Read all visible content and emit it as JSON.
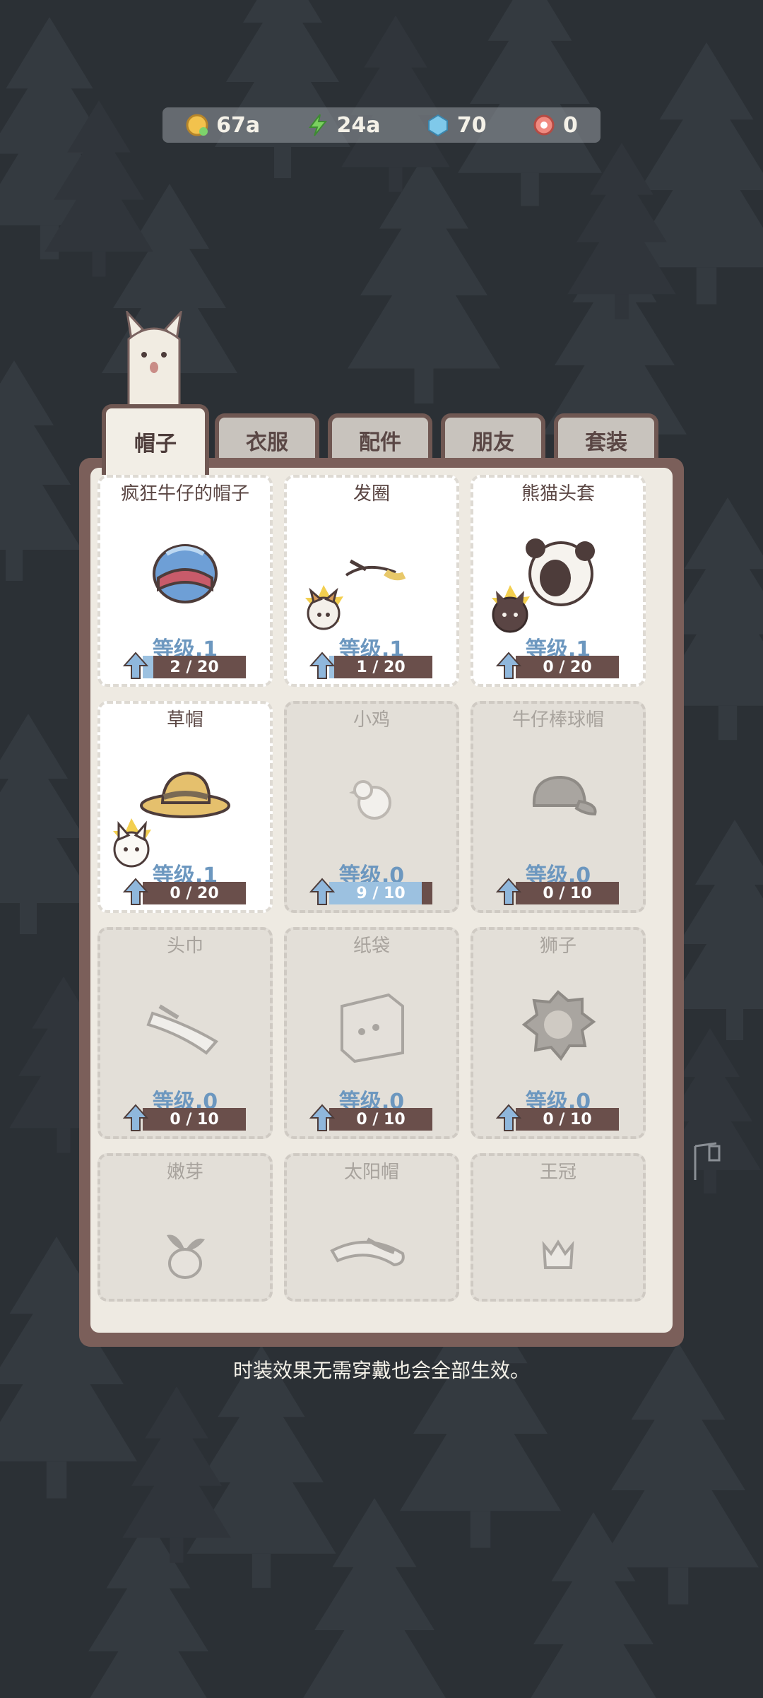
{
  "currencies": [
    {
      "icon": "coin-icon",
      "value": "67a"
    },
    {
      "icon": "lightning-icon",
      "value": "24a"
    },
    {
      "icon": "gem-icon",
      "value": "70"
    },
    {
      "icon": "candy-icon",
      "value": "0"
    }
  ],
  "tabs": [
    "帽子",
    "衣服",
    "配件",
    "朋友",
    "套装"
  ],
  "active_tab": "帽子",
  "items": [
    {
      "name": "疯狂牛仔的帽子",
      "icon": "helmet-icon",
      "level": "等级.1",
      "progress": "2 / 20",
      "fill": 0.1,
      "locked": false,
      "pet": null
    },
    {
      "name": "发圈",
      "icon": "hair-tie-icon",
      "level": "等级.1",
      "progress": "1 / 20",
      "fill": 0.05,
      "locked": false,
      "pet": "corgi-pet-icon"
    },
    {
      "name": "熊猫头套",
      "icon": "panda-hood-icon",
      "level": "等级.1",
      "progress": "0 / 20",
      "fill": 0,
      "locked": false,
      "pet": "black-cat-pet-icon"
    },
    {
      "name": "草帽",
      "icon": "straw-hat-icon",
      "level": "等级.1",
      "progress": "0 / 20",
      "fill": 0,
      "locked": false,
      "pet": "white-cat-pet-icon"
    },
    {
      "name": "小鸡",
      "icon": "chick-icon",
      "level": "等级.0",
      "progress": "9 / 10",
      "fill": 0.9,
      "locked": true,
      "pet": null
    },
    {
      "name": "牛仔棒球帽",
      "icon": "baseball-cap-icon",
      "level": "等级.0",
      "progress": "0 / 10",
      "fill": 0,
      "locked": true,
      "pet": null
    },
    {
      "name": "头巾",
      "icon": "bandana-icon",
      "level": "等级.0",
      "progress": "0 / 10",
      "fill": 0,
      "locked": true,
      "pet": null
    },
    {
      "name": "纸袋",
      "icon": "paper-bag-icon",
      "level": "等级.0",
      "progress": "0 / 10",
      "fill": 0,
      "locked": true,
      "pet": null
    },
    {
      "name": "狮子",
      "icon": "lion-mane-icon",
      "level": "等级.0",
      "progress": "0 / 10",
      "fill": 0,
      "locked": true,
      "pet": null
    },
    {
      "name": "嫩芽",
      "icon": "sprout-icon",
      "level": "",
      "progress": "",
      "fill": 0,
      "locked": true,
      "pet": null
    },
    {
      "name": "太阳帽",
      "icon": "sun-hat-icon",
      "level": "",
      "progress": "",
      "fill": 0,
      "locked": true,
      "pet": null
    },
    {
      "name": "王冠",
      "icon": "crown-icon",
      "level": "",
      "progress": "",
      "fill": 0,
      "locked": true,
      "pet": null
    }
  ],
  "footer_note": "时装效果无需穿戴也会全部生效。"
}
